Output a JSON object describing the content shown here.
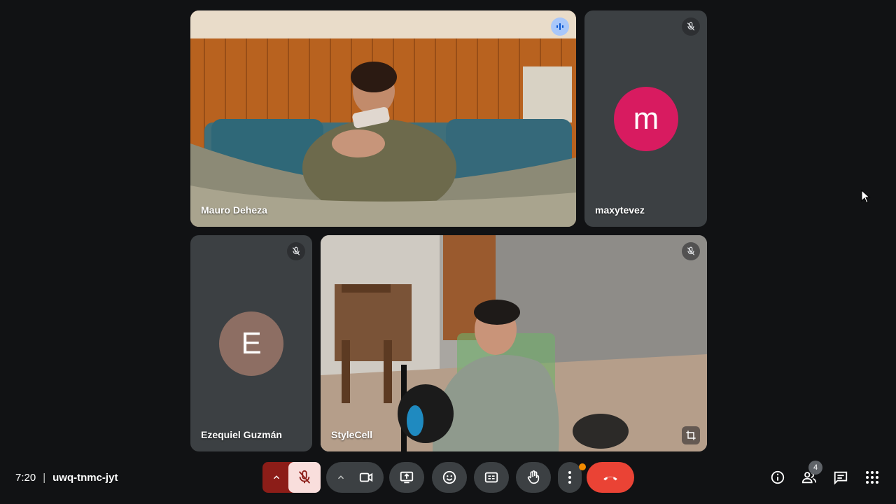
{
  "participants": [
    {
      "name": "Mauro Deheza",
      "type": "video",
      "speaking": true
    },
    {
      "name": "maxytevez",
      "type": "avatar",
      "initial": "m",
      "avatar_color": "#d81b60",
      "muted": true
    },
    {
      "name": "Ezequiel Guzmán",
      "type": "avatar",
      "initial": "E",
      "avatar_color": "#8d6e63",
      "muted": true
    },
    {
      "name": "StyleCell",
      "type": "video",
      "muted": true
    }
  ],
  "meeting": {
    "time": "7:20",
    "separator": "|",
    "code": "uwq-tnmc-jyt"
  },
  "controls": {
    "mic_muted": true,
    "participant_count": "4",
    "end_call_color": "#ea4335",
    "mic_off_bg": "#f9dedc",
    "mic_caret_bg": "#8c1d18"
  },
  "icons": [
    "mic-off-icon",
    "camera-icon",
    "present-icon",
    "emoji-icon",
    "captions-icon",
    "raise-hand-icon",
    "more-icon",
    "end-call-icon",
    "info-icon",
    "people-icon",
    "chat-icon",
    "activities-icon",
    "speaking-indicator-icon",
    "reframe-icon"
  ]
}
